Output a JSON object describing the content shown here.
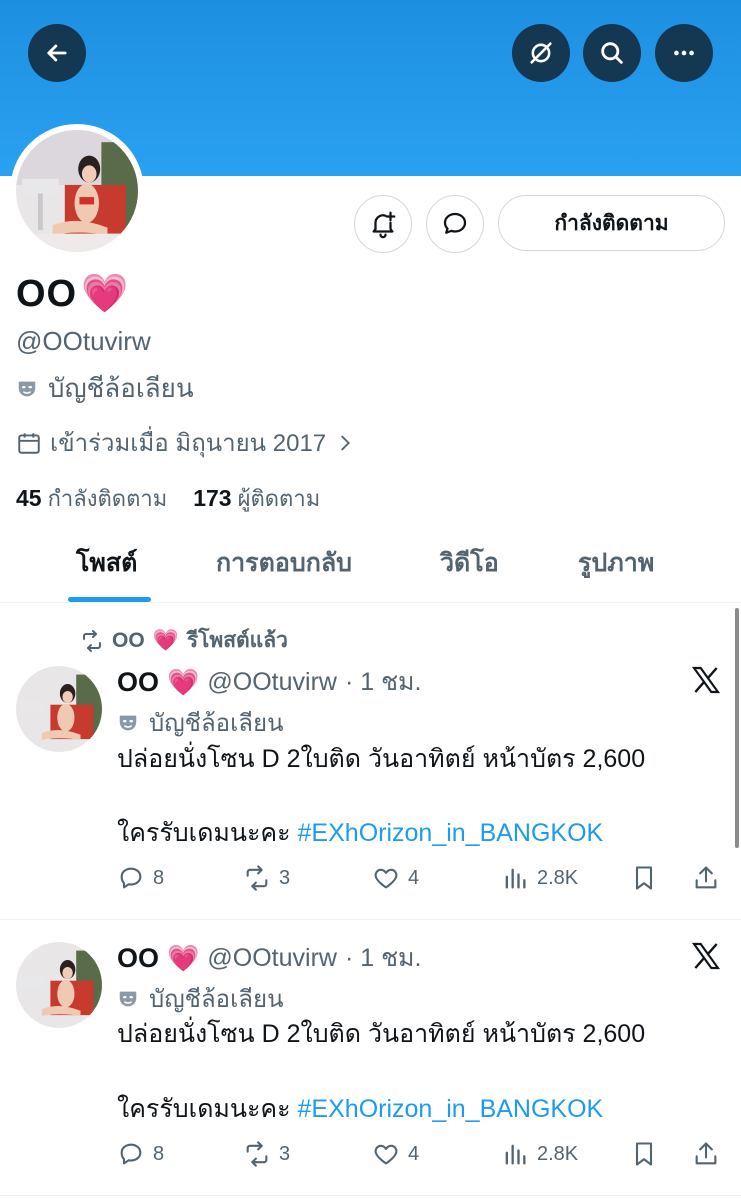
{
  "header": {
    "back_icon": "arrow-left-icon",
    "actions": [
      "hide-icon",
      "search-icon",
      "more-icon"
    ]
  },
  "profile_actions": {
    "notify_icon": "bell-plus-icon",
    "message_icon": "message-icon",
    "following_label": "กำลังติดตาม"
  },
  "profile": {
    "display_name": "OO",
    "heart": "💗",
    "handle": "@OOtuvirw",
    "parody_label": "บัญชีล้อเลียน",
    "joined": "เข้าร่วมเมื่อ มิถุนายน 2017",
    "following_count": "45",
    "following_label": "กำลังติดตาม",
    "followers_count": "173",
    "followers_label": "ผู้ติดตาม"
  },
  "tabs": [
    {
      "label": "โพสต์",
      "active": true
    },
    {
      "label": "การตอบกลับ",
      "active": false
    },
    {
      "label": "วิดีโอ",
      "active": false
    },
    {
      "label": "รูปภาพ",
      "active": false
    }
  ],
  "tweets": [
    {
      "retweet_label": "รีโพสต์แล้ว",
      "retweet_by": "OO",
      "retweet_heart": "💗",
      "name": "OO",
      "heart": "💗",
      "handle": "@OOtuvirw",
      "time": "· 1 ชม.",
      "parody_label": "บัญชีล้อเลียน",
      "line1": "ปล่อยนั่งโซน D 2ใบติด วันอาทิตย์ หน้าบัตร 2,600",
      "line2_text": "ใครรับเดมนะคะ ",
      "hashtag": "#EXhOrizon_in_BANGKOK",
      "replies": "8",
      "reposts": "3",
      "likes": "4",
      "views": "2.8K"
    },
    {
      "name": "OO",
      "heart": "💗",
      "handle": "@OOtuvirw",
      "time": "· 1 ชม.",
      "parody_label": "บัญชีล้อเลียน",
      "line1": "ปล่อยนั่งโซน D 2ใบติด วันอาทิตย์ หน้าบัตร 2,600",
      "line2_text": "ใครรับเดมนะคะ ",
      "hashtag": "#EXhOrizon_in_BANGKOK",
      "replies": "8",
      "reposts": "3",
      "likes": "4",
      "views": "2.8K"
    }
  ],
  "colors": {
    "banner": "#1d8fe1",
    "accent": "#1d9bf0",
    "heart": "#ff3fa4",
    "muted": "#536471"
  }
}
